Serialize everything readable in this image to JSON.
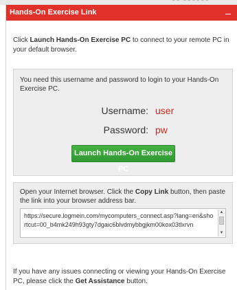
{
  "window": {
    "title": "Hands-On Exercise Link",
    "minimize_symbol": "–",
    "minimize_icon": "minimize-icon",
    "accent_color": "#e0322b"
  },
  "intro": {
    "prefix": "Click ",
    "link_name": "Launch Hands-On Exercise PC",
    "suffix": " to connect to your remote PC in your default browser."
  },
  "credentials": {
    "description": "You need this username and password to login to your Hands-On Exercise PC.",
    "username_label": "Username:",
    "username_value": "user",
    "password_label": "Password:",
    "password_value": "pw",
    "value_color": "#d0281f"
  },
  "launch_button": {
    "label": "Launch Hands-On Exercise PC",
    "color": "#35a437"
  },
  "browser": {
    "instruction_prefix": "Open your Internet browser. Click the ",
    "copy_link": "Copy Link",
    "instruction_suffix": " button, then paste the link into your browser address bar.",
    "url": "https://secure.logmein.com/mycomputers_connect.asp?lang=en&shortcut=00_b4mk249h93gty7dgaic6blvdmybbgjkm00kox03tlxrvn"
  },
  "footer": {
    "prefix": "If you have any issues connecting or viewing your Hands-On Exercise PC, please click the ",
    "assistance": "Get Assistance",
    "suffix": " button."
  }
}
